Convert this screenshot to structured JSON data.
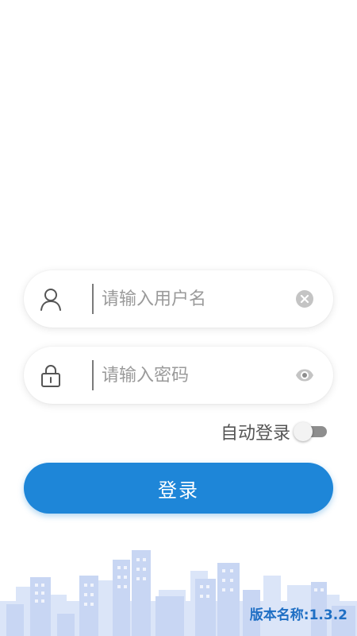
{
  "login_form": {
    "username": {
      "placeholder": "请输入用户名",
      "value": "",
      "leading_icon": "user-icon",
      "trailing_icon": "clear-icon"
    },
    "password": {
      "placeholder": "请输入密码",
      "value": "",
      "leading_icon": "lock-icon",
      "trailing_icon": "eye-icon"
    },
    "auto_login": {
      "label": "自动登录",
      "enabled": false
    },
    "submit_label": "登录"
  },
  "footer": {
    "version_text": "版本名称:1.3.2",
    "background_icon": "city-skyline"
  },
  "colors": {
    "primary": "#1e86d8",
    "version_text": "#1f6fc4",
    "skyline": "#c8d8f4"
  }
}
